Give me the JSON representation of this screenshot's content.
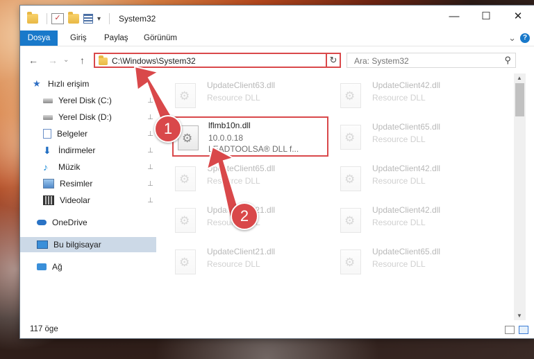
{
  "window": {
    "title": "System32",
    "controls": {
      "minimize": "—",
      "maximize": "☐",
      "close": "✕"
    }
  },
  "quick_access_toolbar": {
    "dropdown_glyph": "▾"
  },
  "ribbon": {
    "tabs": [
      "Dosya",
      "Giriş",
      "Paylaş",
      "Görünüm"
    ],
    "collapse_glyph": "⌄",
    "help_glyph": "?"
  },
  "address_bar": {
    "back_glyph": "←",
    "forward_glyph": "→",
    "history_glyph": "⌄",
    "up_glyph": "↑",
    "path": "C:\\Windows\\System32",
    "dropdown_glyph": "⌄",
    "refresh_glyph": "↻",
    "search_placeholder": "Ara: System32",
    "search_glyph": "⚲"
  },
  "sidebar": {
    "items": [
      {
        "label": "Hızlı erişim",
        "icon": "star-icon",
        "pinned": false
      },
      {
        "label": "Yerel Disk (C:)",
        "icon": "drive-icon",
        "pinned": true
      },
      {
        "label": "Yerel Disk (D:)",
        "icon": "drive-icon",
        "pinned": true
      },
      {
        "label": "Belgeler",
        "icon": "documents-icon",
        "pinned": true
      },
      {
        "label": "İndirmeler",
        "icon": "downloads-icon",
        "pinned": true
      },
      {
        "label": "Müzik",
        "icon": "music-icon",
        "pinned": true
      },
      {
        "label": "Resimler",
        "icon": "pictures-icon",
        "pinned": true
      },
      {
        "label": "Videolar",
        "icon": "videos-icon",
        "pinned": true
      },
      {
        "label": "OneDrive",
        "icon": "cloud-icon",
        "pinned": false
      },
      {
        "label": "Bu bilgisayar",
        "icon": "computer-icon",
        "pinned": false,
        "selected": true
      },
      {
        "label": "Ağ",
        "icon": "network-icon",
        "pinned": false
      }
    ],
    "pin_glyph": "📌"
  },
  "files": [
    {
      "name": "UpdateClient63.dll",
      "line1": "Resource DLL",
      "line2": ""
    },
    {
      "name": "UpdateClient42.dll",
      "line1": "Resource DLL",
      "line2": ""
    },
    {
      "name": "lflmb10n.dll",
      "line1": "10.0.0.18",
      "line2": "LEADTOOLSA® DLL f..."
    },
    {
      "name": "UpdateClient65.dll",
      "line1": "Resource DLL",
      "line2": ""
    },
    {
      "name": "UpdateClient65.dll",
      "line1": "Resource DLL",
      "line2": ""
    },
    {
      "name": "UpdateClient42.dll",
      "line1": "Resource DLL",
      "line2": ""
    },
    {
      "name": "UpdateClient21.dll",
      "line1": "Resource DLL",
      "line2": ""
    },
    {
      "name": "UpdateClient42.dll",
      "line1": "Resource DLL",
      "line2": ""
    },
    {
      "name": "UpdateClient21.dll",
      "line1": "Resource DLL",
      "line2": ""
    },
    {
      "name": "UpdateClient65.dll",
      "line1": "Resource DLL",
      "line2": ""
    }
  ],
  "status": {
    "item_count": "117 öge"
  },
  "annotations": {
    "step1": "1",
    "step2": "2",
    "color": "#d9484a"
  },
  "colors": {
    "accent": "#1979ca",
    "highlight": "#d9484a",
    "selected_nav": "#ccd9e7"
  }
}
